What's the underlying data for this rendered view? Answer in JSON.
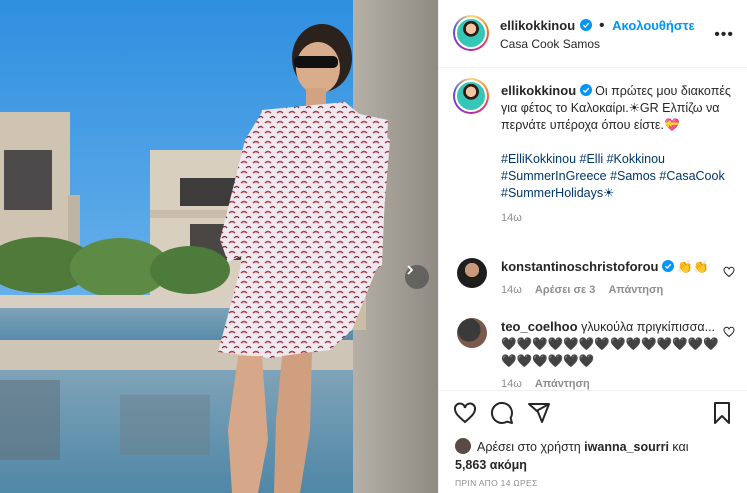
{
  "post": {
    "username": "ellikokkinou",
    "follow_label": "Ακολουθήστε",
    "location": "Casa Cook Samos",
    "more_label": "•••"
  },
  "caption": {
    "username": "ellikokkinou",
    "text": "Οι πρώτες μου διακοπές για φέτος το Καλοκαίρι.☀GR Ελπίζω να περνάτε υπέροχα όπου είστε.💝",
    "hashtags": "#ElliKokkinou #Elli #Kokkinou #SummerInGreece #Samos #CasaCook #SummerHolidays☀",
    "time": "14ω"
  },
  "comments": [
    {
      "username": "konstantinoschristoforou",
      "text": "👏👏",
      "time": "14ω",
      "likes": "Αρέσει σε 3",
      "reply": "Απάντηση"
    },
    {
      "username": "teo_coelhoo",
      "text": "γλυκούλα πριγκίπισσα...🖤🖤🖤🖤🖤🖤🖤🖤🖤🖤🖤🖤🖤🖤🖤🖤🖤🖤🖤🖤",
      "time": "14ω",
      "reply": "Απάντηση"
    }
  ],
  "likes": {
    "prefix": "Αρέσει στο χρήστη",
    "user": "iwanna_sourri",
    "conj": "και",
    "count": "5,863 ακόμη"
  },
  "time_ago": "ΠΡΙΝ ΑΠΟ 14 ΩΡΕΣ",
  "icons": {
    "like": "heart-icon",
    "comment": "comment-icon",
    "share": "share-icon",
    "save": "bookmark-icon",
    "next": "chevron-right-icon",
    "verified": "verified-badge-icon"
  },
  "colors": {
    "link": "#0095f6",
    "hashtag": "#00376b",
    "muted": "#8e8e8e"
  }
}
